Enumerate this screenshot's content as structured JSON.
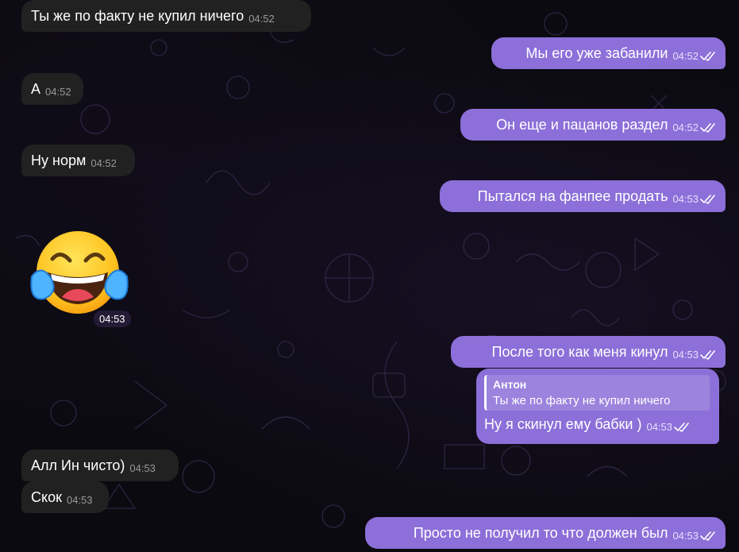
{
  "messages": [
    {
      "text": "Ты же по факту не купил ничего",
      "time": "04:52"
    },
    {
      "text": "Мы его уже забанили",
      "time": "04:52"
    },
    {
      "text": "А",
      "time": "04:52"
    },
    {
      "text": "Он еще и пацанов раздел",
      "time": "04:52"
    },
    {
      "text": "Ну норм",
      "time": "04:52"
    },
    {
      "text": "Пытался на фанпее продать",
      "time": "04:53"
    },
    {
      "text": "После того как меня кинул",
      "time": "04:53"
    },
    {
      "reply_author": "Антон",
      "reply_text": "Ты же по факту не купил ничего",
      "text": "Ну я скинул ему бабки )",
      "time": "04:53"
    },
    {
      "text": "Алл Ин чисто)",
      "time": "04:53"
    },
    {
      "text": "Скок",
      "time": "04:53"
    },
    {
      "text": "Просто не получил то что должен был",
      "time": "04:53"
    }
  ],
  "sticker": {
    "icon": "laughing-tears-emoji-icon",
    "time": "04:53"
  },
  "colors": {
    "incoming_bubble": "#212121",
    "outgoing_bubble": "#8c6fd8",
    "background": "#0b0a10"
  }
}
